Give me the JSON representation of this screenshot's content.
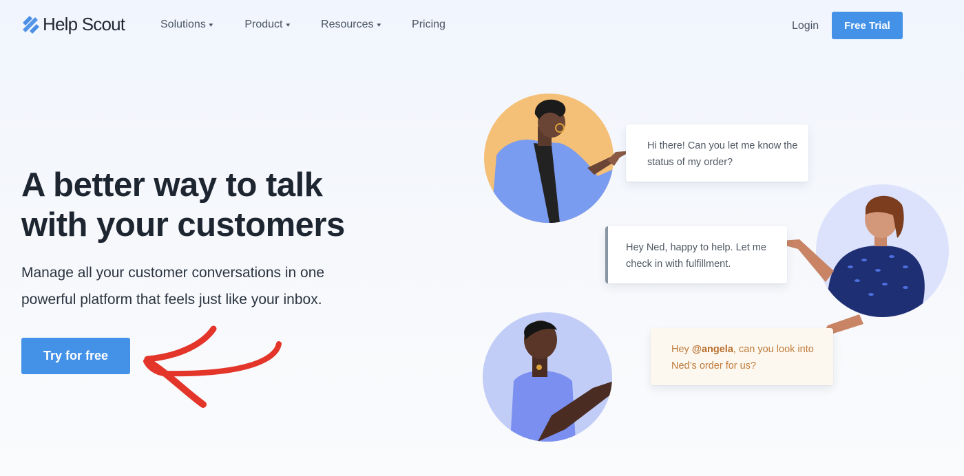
{
  "nav": {
    "logo_text": "Help Scout",
    "links": [
      {
        "label": "Solutions",
        "has_dropdown": true
      },
      {
        "label": "Product",
        "has_dropdown": true
      },
      {
        "label": "Resources",
        "has_dropdown": true
      },
      {
        "label": "Pricing",
        "has_dropdown": false
      }
    ],
    "chevron_glyph": "⌄",
    "login_label": "Login",
    "free_trial_label": "Free Trial"
  },
  "hero": {
    "headline_line1": "A better way to talk",
    "headline_line2": "with your customers",
    "subhead_line1": "Manage all your customer conversations in one",
    "subhead_line2": "powerful platform that feels just like your inbox.",
    "cta_label": "Try for free"
  },
  "conversation": {
    "bubble1": "Hi there! Can you let me know the status of my order?",
    "bubble2": "Hey Ned, happy to help. Let me check in with fulfillment.",
    "bubble3_prefix": "Hey ",
    "bubble3_mention": "@angela",
    "bubble3_suffix": ", can you look into Ned’s order for us?"
  },
  "colors": {
    "brand_blue": "#4491e8",
    "annotation_red": "#e3352a",
    "mention_orange": "#b86d2c"
  }
}
